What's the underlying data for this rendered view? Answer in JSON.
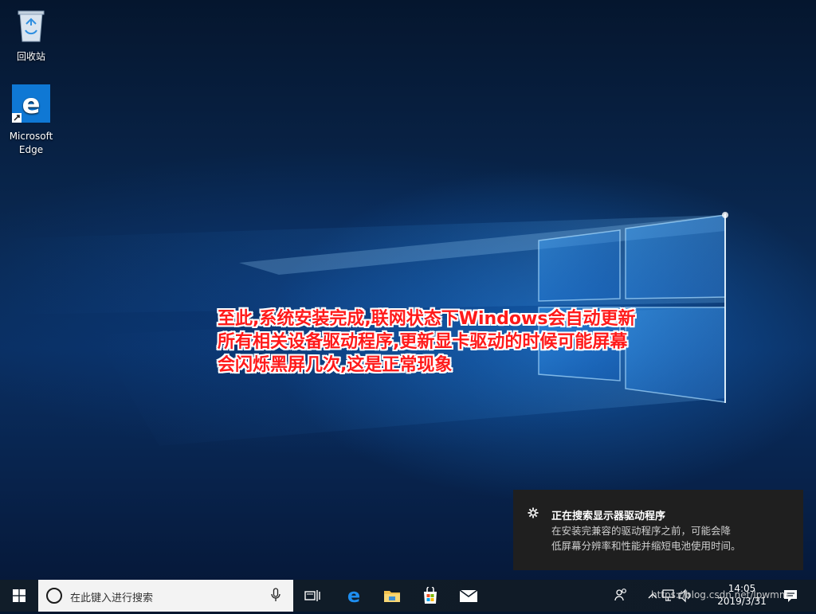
{
  "desktop": {
    "icons": [
      {
        "label": "回收站",
        "icon": "recycle-bin-icon"
      },
      {
        "label_line1": "Microsoft",
        "label_line2": "Edge",
        "icon": "edge-icon"
      }
    ]
  },
  "annotation": {
    "lines": [
      "至此,系统安装完成,联网状态下Windows会自动更新",
      "所有相关设备驱动程序,更新显卡驱动的时候可能屏幕",
      "会闪烁黑屏几次,这是正常现象"
    ],
    "color": "#ff1a1a",
    "outline": "#ffffff"
  },
  "notification": {
    "icon": "gear-icon",
    "title": "正在搜索显示器驱动程序",
    "body_line1": "在安装完兼容的驱动程序之前，可能会降",
    "body_line2": "低屏幕分辨率和性能并缩短电池使用时间。"
  },
  "taskbar": {
    "search_placeholder": "在此键入进行搜索",
    "pinned": [
      "task-view-icon",
      "edge-icon",
      "file-explorer-icon",
      "store-icon",
      "mail-icon"
    ],
    "tray_icons": [
      "people-icon",
      "chevron-up-icon",
      "network-icon",
      "volume-icon",
      "notification-icon"
    ],
    "time": "14:05",
    "date": "2019/3/31",
    "watermark": "https://blog.csdn.net/lpwmm"
  },
  "colors": {
    "taskbar": "#0f1a26",
    "toast": "#1f1f1f",
    "accent": "#0078d7"
  }
}
